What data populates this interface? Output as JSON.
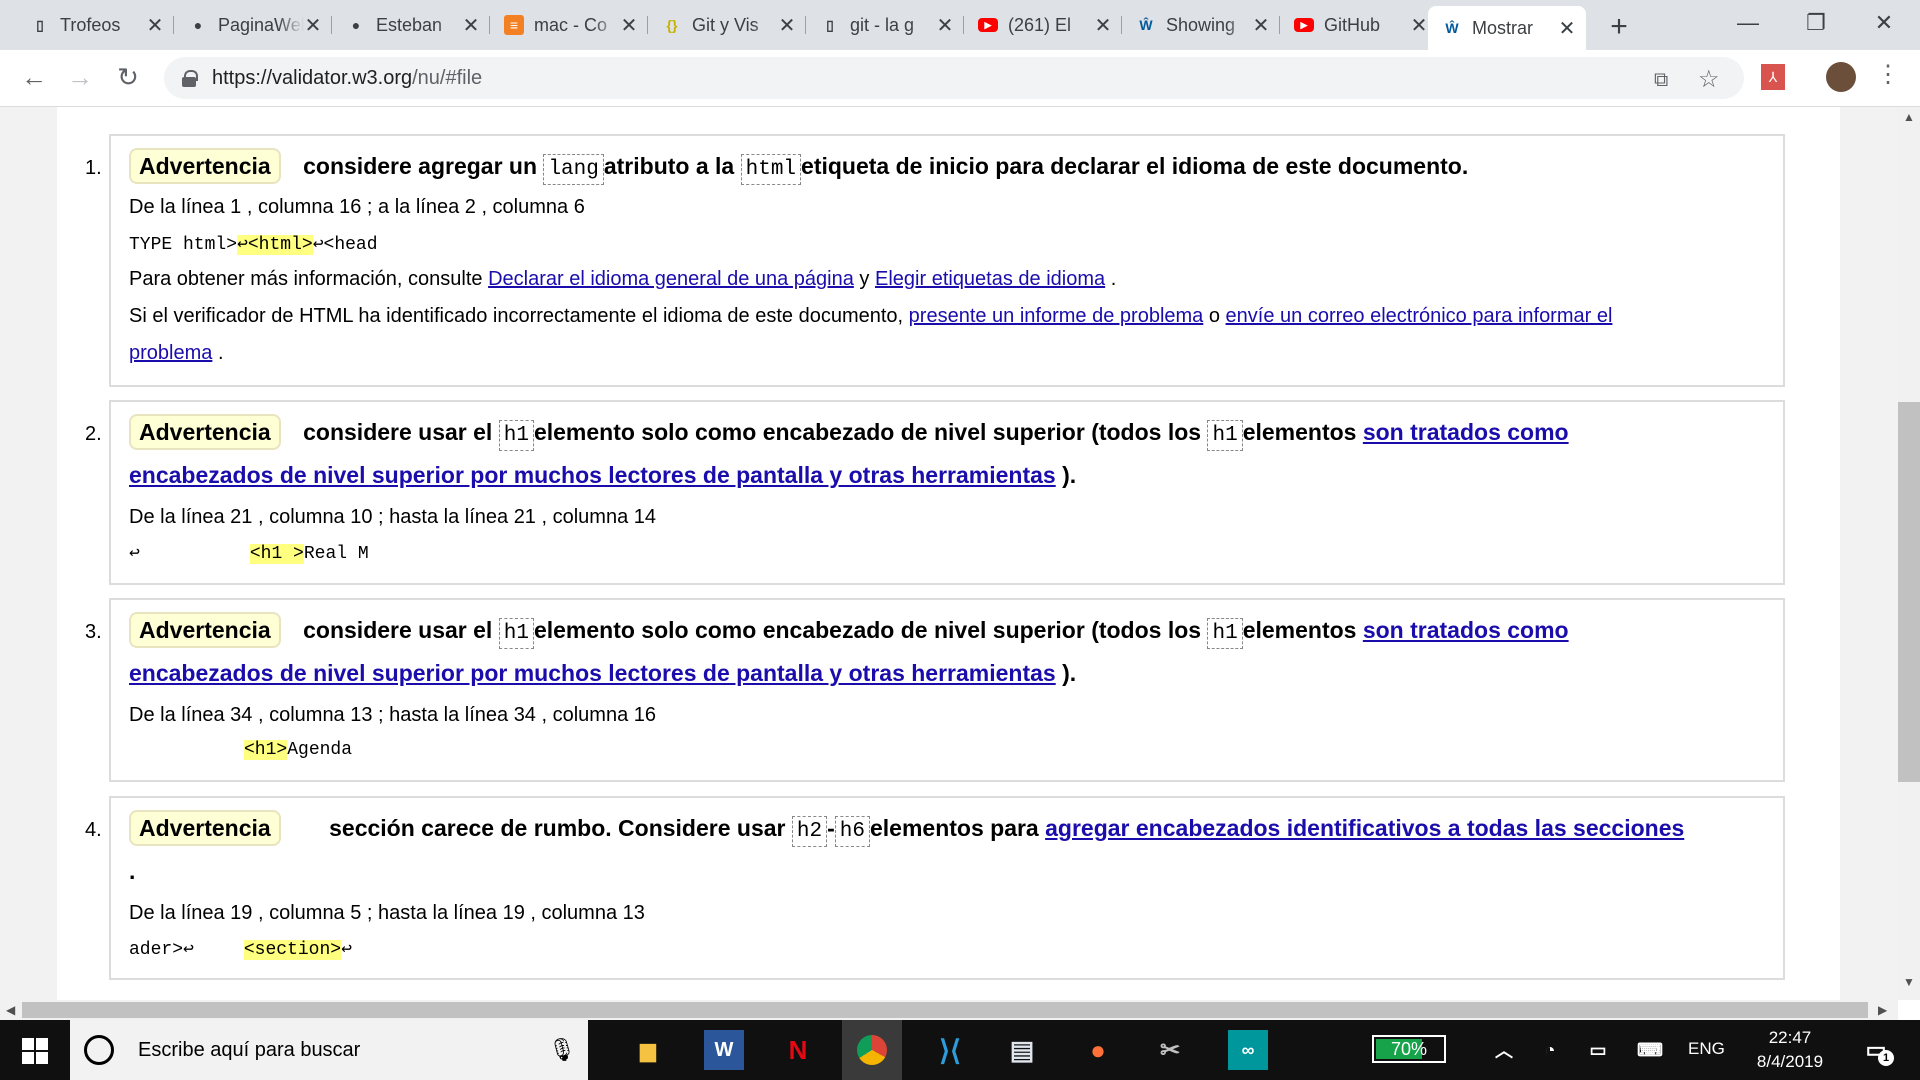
{
  "tabs": [
    {
      "title": "Trofeos",
      "icon": "page-icon"
    },
    {
      "title": "PaginaWeb",
      "icon": "github-icon"
    },
    {
      "title": "Esteban",
      "icon": "github-icon"
    },
    {
      "title": "mac - Co",
      "icon": "stackoverflow-icon"
    },
    {
      "title": "Git y Vis",
      "icon": "js-icon"
    },
    {
      "title": "git - la g",
      "icon": "page-icon"
    },
    {
      "title": "(261) El",
      "icon": "youtube-icon"
    },
    {
      "title": "Showing",
      "icon": "w3c-icon"
    },
    {
      "title": "GitHub",
      "icon": "youtube-icon"
    },
    {
      "title": "Mostrar",
      "icon": "w3c-icon"
    }
  ],
  "url": {
    "base": "https://validator.w3.org",
    "rest": "/nu/#file"
  },
  "warnings": [
    {
      "n": "1.",
      "badge": "Advertencia",
      "t1": "considere agregar un ",
      "c1": "lang",
      "t2": "atributo a la ",
      "c2": "html",
      "t3": "etiqueta de inicio para declarar el idioma de este documento.",
      "loc": "De la línea 1 , columna 16 ; a la línea 2 , columna 6",
      "ext_pre": "TYPE html>",
      "ext_arrow1": "↩",
      "ext_hl": "<html>",
      "ext_arrow2": "↩",
      "ext_post": "<head",
      "info_pre": "Para obtener más información, consulte ",
      "info_link1": "Declarar el idioma general de una página",
      "info_mid": " y ",
      "info_link2": "Elegir etiquetas de idioma",
      "info_end": " .",
      "err_pre": "Si el verificador de HTML ha identificado incorrectamente el idioma de este documento, ",
      "err_link1": "presente un informe de problema",
      "err_mid": " o ",
      "err_link2a": "envíe un correo electrónico para informar el",
      "err_link2b": "problema",
      "err_end": " ."
    },
    {
      "n": "2.",
      "badge": "Advertencia",
      "t1": "considere usar el ",
      "c1": "h1",
      "t2": "elemento solo como encabezado de nivel superior (todos los ",
      "c2": "h1",
      "t3": "elementos ",
      "link_a": "son tratados como",
      "link_b": "encabezados de nivel superior por muchos lectores de pantalla y otras herramientas",
      "tend": " ).",
      "loc": "De la línea 21 , columna 10 ; hasta la línea 21 , columna 14",
      "ext_arrow": "↩",
      "ext_hl": "<h1 >",
      "ext_post": "Real M"
    },
    {
      "n": "3.",
      "badge": "Advertencia",
      "t1": "considere usar el ",
      "c1": "h1",
      "t2": "elemento solo como encabezado de nivel superior (todos los ",
      "c2": "h1",
      "t3": "elementos ",
      "link_a": "son tratados como",
      "link_b": "encabezados de nivel superior por muchos lectores de pantalla y otras herramientas",
      "tend": " ).",
      "loc": "De la línea 34 , columna 13 ; hasta la línea 34 , columna 16",
      "ext_hl": "<h1>",
      "ext_post": "Agenda"
    },
    {
      "n": "4.",
      "badge": "Advertencia",
      "t1": "sección carece de rumbo. Considere usar ",
      "c1": "h2",
      "dash": "-",
      "c2": "h6",
      "t2": "elementos para ",
      "link": "agregar encabezados identificativos a todas las secciones",
      "t3": ".",
      "loc": "De la línea 19 , columna 5 ; hasta la línea 19 , columna 13",
      "ext_pre": "ader>",
      "ext_arrow1": "↩",
      "ext_hl": "<section>",
      "ext_arrow2": "↩"
    }
  ],
  "taskbar": {
    "search_placeholder": "Escribe aquí para buscar",
    "battery": "70%",
    "battery_level": 0.7,
    "lang": "ENG",
    "time": "22:47",
    "date": "8/4/2019",
    "notif_count": "1"
  },
  "colors": {
    "tab_bar": "#dee1e6",
    "badge_bg": "#ffffd6",
    "highlight": "#ffff80",
    "link": "#1a0dab",
    "taskbar": "#101010"
  }
}
